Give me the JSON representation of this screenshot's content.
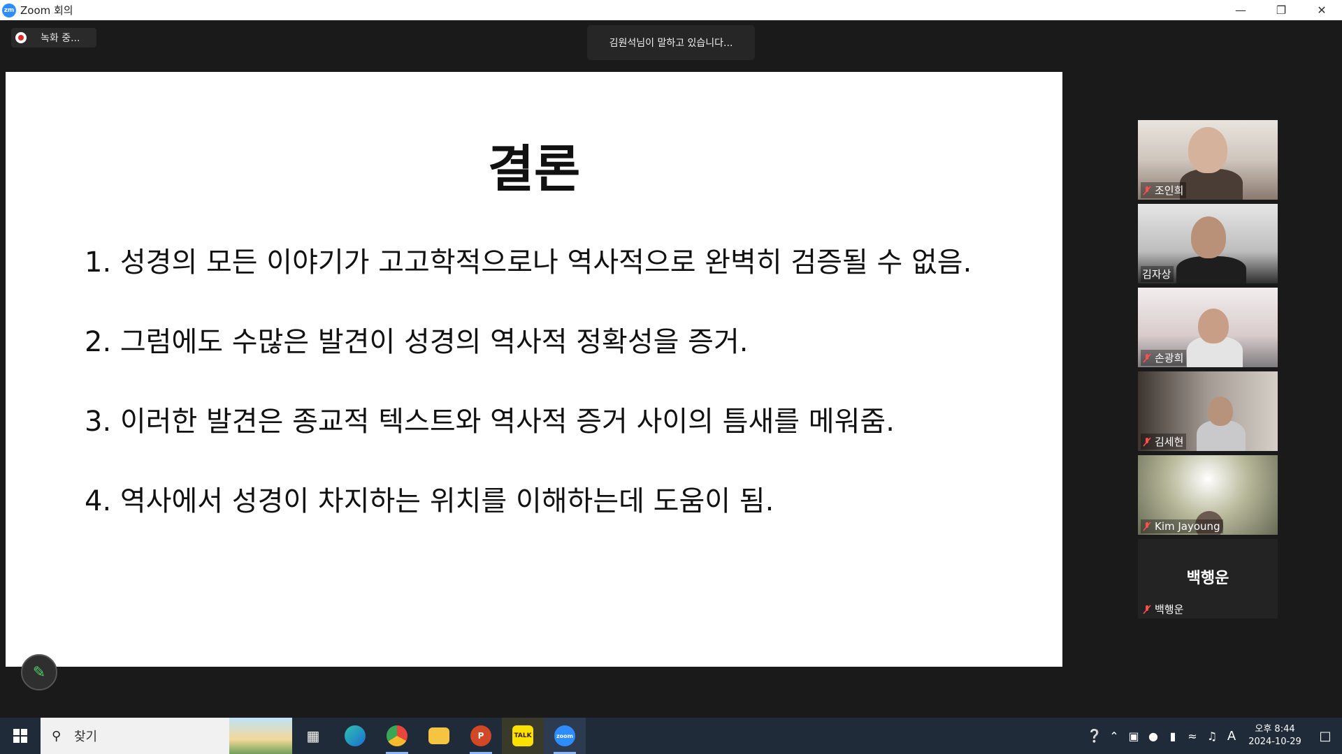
{
  "window": {
    "title": "Zoom 회의",
    "app_icon": "zm"
  },
  "recording": {
    "label": "녹화 중..."
  },
  "speaking_banner": "김원석님이 말하고 있습니다...",
  "slide": {
    "title": "결론",
    "items": [
      "1. 성경의 모든 이야기가 고고학적으로나 역사적으로 완벽히 검증될 수 없음.",
      "2. 그럼에도 수많은 발견이 성경의 역사적 정확성을 증거.",
      "3. 이러한 발견은 종교적 텍스트와 역사적 증거 사이의 틈새를 메워줌.",
      "4. 역사에서 성경이 차지하는 위치를 이해하는데 도움이 됨."
    ]
  },
  "participants": [
    {
      "name": "조인희",
      "muted": true
    },
    {
      "name": "김자상",
      "muted": false
    },
    {
      "name": "손광희",
      "muted": true
    },
    {
      "name": "김세현",
      "muted": true
    },
    {
      "name": "Kim Jayoung",
      "muted": true
    },
    {
      "name": "백행운",
      "muted": true,
      "display_name": "백행운"
    }
  ],
  "taskbar": {
    "search_placeholder": "찾기",
    "apps": [
      "task-view",
      "edge",
      "chrome",
      "file-explorer",
      "powerpoint",
      "kakaotalk",
      "zoom"
    ],
    "kakao_label": "TALK",
    "zoom_label": "zoom",
    "clock_time": "오후 8:44",
    "clock_date": "2024-10-29",
    "ime": "A"
  },
  "colors": {
    "accent": "#2d8cff",
    "record": "#e02828",
    "taskbar": "#202b3a"
  }
}
